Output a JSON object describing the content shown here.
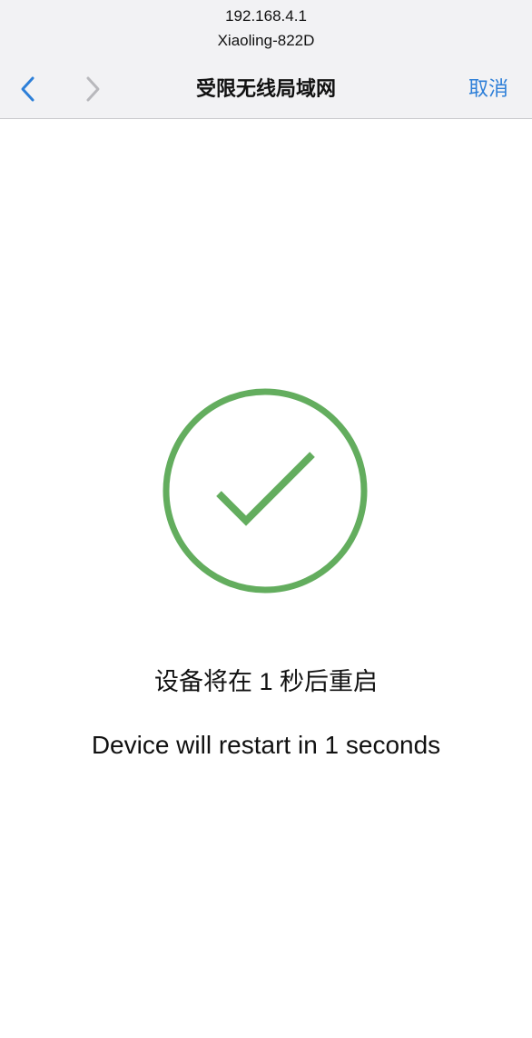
{
  "header": {
    "url": "192.168.4.1",
    "ssid": "Xiaoling-822D",
    "title": "受限无线局域网",
    "cancel_label": "取消",
    "back_icon": "chevron-left-icon",
    "forward_icon": "chevron-right-icon"
  },
  "status": {
    "icon": "check-circle-icon",
    "message_cn": "设备将在 1 秒后重启",
    "message_en": "Device will restart in 1 seconds"
  },
  "colors": {
    "accent": "#2d7fd8",
    "success": "#63ad5e",
    "disabled": "#b8b8bc"
  }
}
